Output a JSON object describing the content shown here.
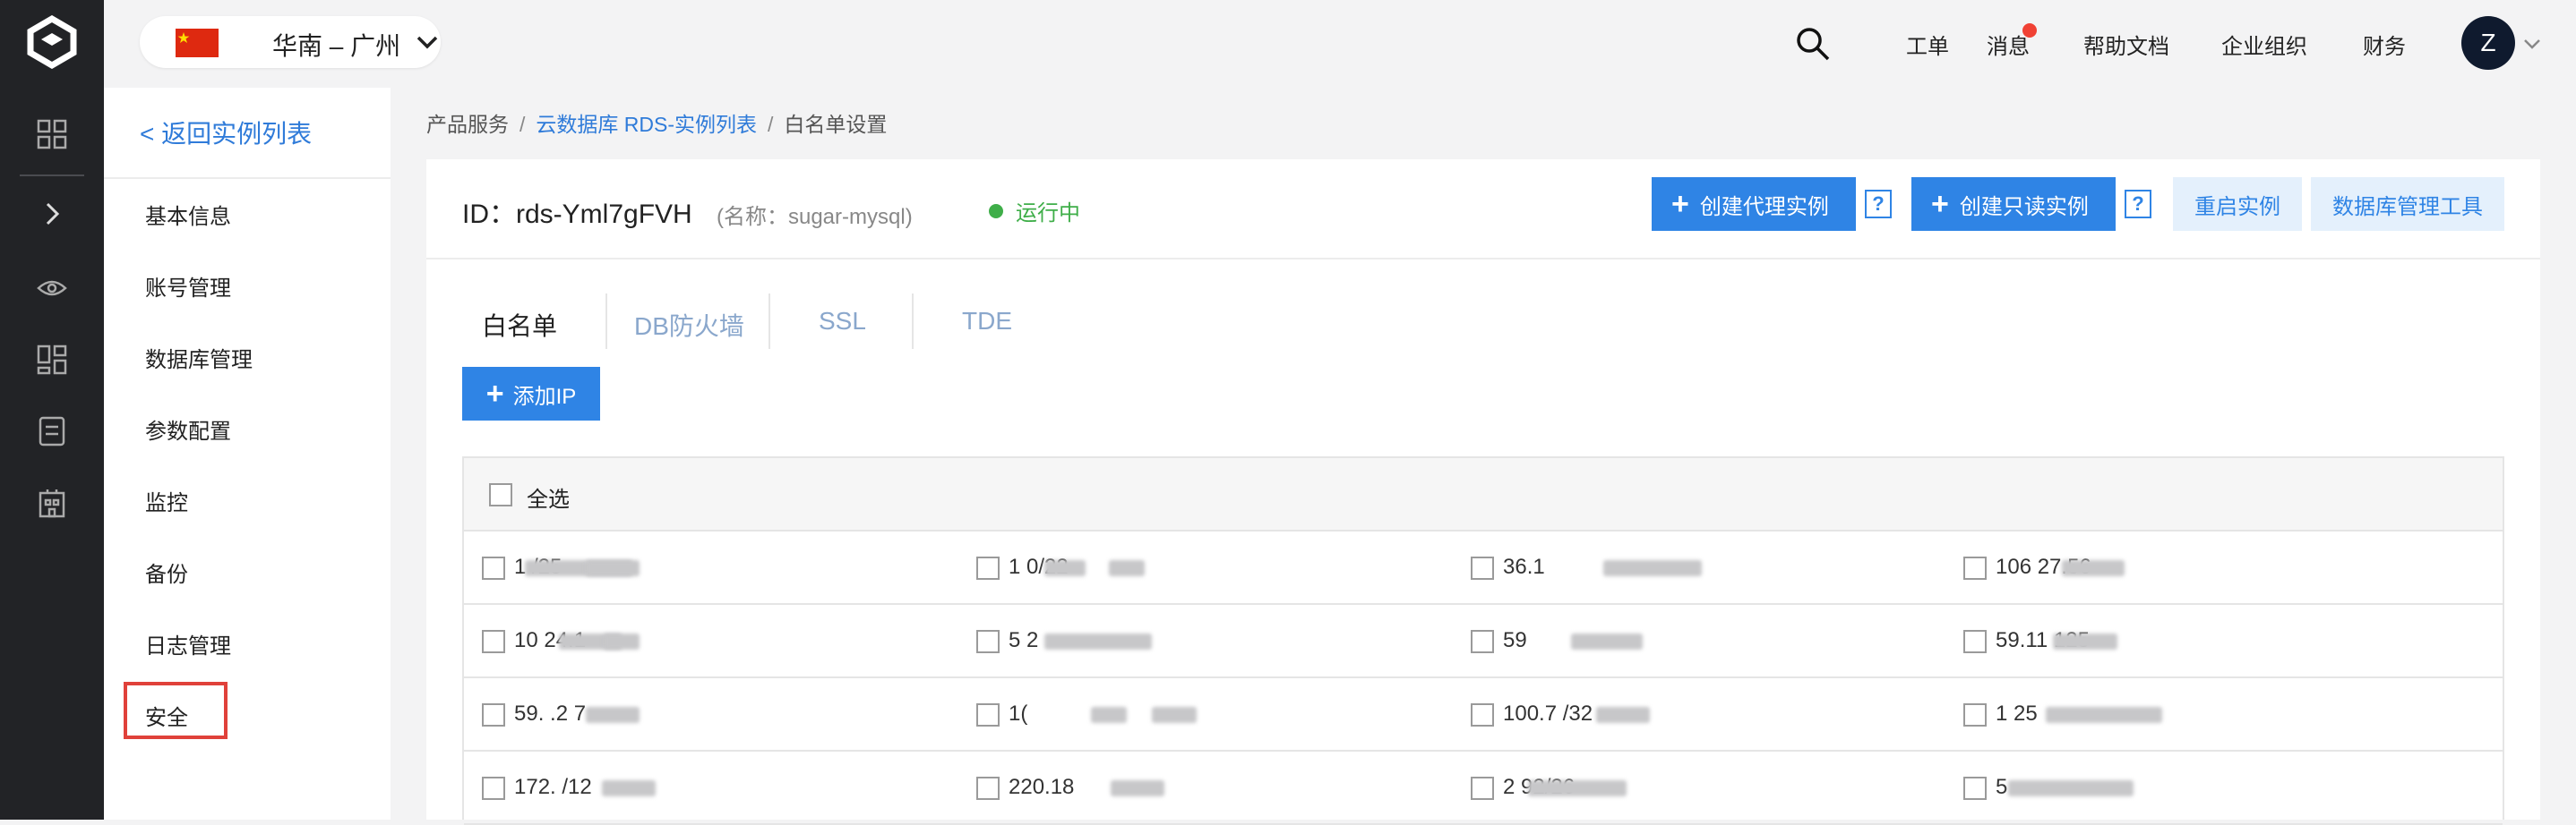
{
  "topbar": {
    "region_label": "华南 – 广州",
    "nav": [
      "工单",
      "消息",
      "帮助文档",
      "企业组织",
      "财务"
    ],
    "avatar_letter": "Z"
  },
  "submenu": {
    "back_label": "< 返回实例列表",
    "items": [
      "基本信息",
      "账号管理",
      "数据库管理",
      "参数配置",
      "监控",
      "备份",
      "日志管理",
      "安全"
    ]
  },
  "breadcrumb": {
    "items": [
      "产品服务",
      "云数据库 RDS-实例列表",
      "白名单设置"
    ]
  },
  "instance": {
    "id_text": "ID：rds-Yml7gFVH",
    "name_text": "(名称：sugar-mysql)",
    "status": "运行中"
  },
  "actions": {
    "create_proxy": "创建代理实例",
    "create_readonly": "创建只读实例",
    "restart": "重启实例",
    "db_tool": "数据库管理工具",
    "help": "?"
  },
  "tabs": [
    "白名单",
    "DB防火墙",
    "SSL",
    "TDE"
  ],
  "whitelist": {
    "add_ip": "添加IP",
    "select_all": "全选",
    "rows": [
      [
        "1 /25",
        "1 0/22",
        "36.1",
        "106 27.56"
      ],
      [
        "10 24.1",
        "5 2",
        "59",
        "59.11 125"
      ],
      [
        "59. .2 7",
        "1(",
        "100.7 /32",
        "1 25"
      ],
      [
        "172. /12",
        "220.18",
        "2 92/26",
        "5"
      ]
    ]
  },
  "colors": {
    "accent": "#2f84e5",
    "link": "#2f7bd9",
    "status_ok": "#3fae49",
    "highlight": "#e0413a",
    "rail": "#222326"
  }
}
